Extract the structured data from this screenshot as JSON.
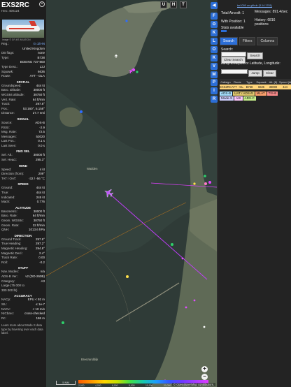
{
  "info": {
    "callsign": "EXS2RC",
    "hex_line": "Hex: 400124",
    "registration_link": "G-JZHN",
    "photo_credit": "Image © GF-MT AVIATION",
    "general": [
      {
        "label": "Reg.:",
        "value": ""
      },
      {
        "label": "",
        "value": "United Kingdom"
      },
      {
        "label": "DB flags:",
        "value": "none"
      },
      {
        "label": "Type:",
        "value": "B738"
      },
      {
        "label": "",
        "value": "BOEING 737-800"
      },
      {
        "label": "Type Desc.:",
        "value": "L2J"
      },
      {
        "label": "Squawk:",
        "value": "6636"
      },
      {
        "label": "Route:",
        "value": "AYT - GLA"
      }
    ],
    "spatial_title": "SPATIAL",
    "spatial": [
      {
        "label": "Groundspeed:",
        "value": "444 kt"
      },
      {
        "label": "Baro. altitude:",
        "value": "38000 ft"
      },
      {
        "label": "WGS84 altitude:",
        "value": "38750 ft"
      },
      {
        "label": "Vert. Rate:",
        "value": "64 ft/min"
      },
      {
        "label": "Track:",
        "value": "297.8°"
      },
      {
        "label": "Pos.:",
        "value": "53.160°, 5.158°"
      },
      {
        "label": "Distance:",
        "value": "27.7 nmi"
      }
    ],
    "signal_title": "SIGNAL",
    "signal": [
      {
        "label": "Source:",
        "value": "ADS-B"
      },
      {
        "label": "RSSI:",
        "value": "-2.9"
      },
      {
        "label": "Msg. Rate:",
        "value": "72.5"
      },
      {
        "label": "Messages:",
        "value": "53020"
      },
      {
        "label": "Last Pos.:",
        "value": "0.1 s"
      },
      {
        "label": "Last Seen:",
        "value": "0.0 s"
      }
    ],
    "fms_title": "FMS SEL",
    "fms": [
      {
        "label": "Sel. Alt.:",
        "value": "38000 ft"
      },
      {
        "label": "Sel. Head.:",
        "value": "295.3°"
      }
    ],
    "wind_title": "WIND",
    "wind": [
      {
        "label": "Speed:",
        "value": "4 kt"
      },
      {
        "label": "Direction (from):",
        "value": "209°"
      },
      {
        "label": "TAT / OAT:",
        "value": "-32 / -56 °C"
      }
    ],
    "speed_title": "SPEED",
    "speed": [
      {
        "label": "Ground:",
        "value": "444 kt"
      },
      {
        "label": "True:",
        "value": "444 kt"
      },
      {
        "label": "Indicated:",
        "value": "245 kt"
      },
      {
        "label": "Mach:",
        "value": "0.776"
      }
    ],
    "altitude_title": "ALTITUDE",
    "altitude": [
      {
        "label": "Barometric:",
        "value": "38000 ft"
      },
      {
        "label": "Baro. Rate:",
        "value": "64 ft/min"
      },
      {
        "label": "Geom. WGS84:",
        "value": "38750 ft"
      },
      {
        "label": "Geom. Rate:",
        "value": "32 ft/min"
      },
      {
        "label": "QNH:",
        "value": "1013.6 hPa"
      }
    ],
    "direction_title": "DIRECTION",
    "direction": [
      {
        "label": "Ground Track:",
        "value": "297.8°"
      },
      {
        "label": "True Heading:",
        "value": "297.2°"
      },
      {
        "label": "Magnetic Heading:",
        "value": "294.8°"
      },
      {
        "label": "Magnetic Decl.:",
        "value": "2.4°"
      },
      {
        "label": "Track Rate:",
        "value": "0.00"
      },
      {
        "label": "Roll:",
        "value": "-0.2"
      }
    ],
    "stuff_title": "STUFF",
    "stuff": [
      {
        "label": "Nav. Modes:",
        "value": "n/a"
      },
      {
        "label": "ADS-B Ver.:",
        "value": "v2 (DO-260B)"
      },
      {
        "label": "Category:",
        "value": "A3"
      },
      {
        "label": "Large (75 000 to",
        "value": ""
      },
      {
        "label": "300 000 lb)",
        "value": ""
      }
    ],
    "accuracy_title": "ACCURACY",
    "accuracy": [
      {
        "label": "NACp:",
        "value": "EPU < 92 m"
      },
      {
        "label": "SIL:",
        "value": "≤ 1e-7"
      },
      {
        "label": "NACv:",
        "value": "< 10 m/s"
      },
      {
        "label": "NICbaro:",
        "value": "cross-checked"
      },
      {
        "label": "Rc:",
        "value": "186 m"
      }
    ],
    "footer": "Learn more about Mode S data type by hovering over each data label."
  },
  "map": {
    "top_buttons": [
      "U",
      "H",
      "T"
    ],
    "zoom_in": "+",
    "zoom_out": "−",
    "scale_label": "5 NM",
    "attribution": "© OpenStreetMap contributors.",
    "place_labels": [
      "Wadden",
      "Breezanddijk"
    ],
    "legend_ticks": [
      "2,000",
      "4,000",
      "6,000",
      "8,000",
      "10,000",
      "20,000",
      "30,000",
      "40,000+"
    ]
  },
  "tools": [
    "◀",
    "F",
    "⊙",
    "K",
    "L",
    "O",
    "K",
    "V",
    "M",
    "P",
    "I",
    "R"
  ],
  "right": {
    "top_link": "tar1090 on github (3.14.1781)",
    "total_aircraft": "Total Aircraft: 1",
    "messages": "Messages: 891.4/sec",
    "with_position": "With Position: 1",
    "history": "History: 6816 positions",
    "stats_label": "Stats available",
    "tabs": [
      "Search",
      "Filters",
      "Columns"
    ],
    "search_label": "Search:",
    "search_button": "Search",
    "clear_search": "Clear Search",
    "jump_label": "Jump to Airport or Latitude, Longitude:",
    "jump_button": "Jump",
    "clear_button": "Clear",
    "table_headers": [
      "Callsign",
      "Route",
      "Type",
      "Squawk",
      "Alt. (ft)",
      "Speed (kt)"
    ],
    "table_row": [
      "EXS2RC",
      "AYT - GLA",
      "B738",
      "6636",
      "38000",
      "444"
    ],
    "source_chips": [
      {
        "label": "ADS-B",
        "color": "#a6e0ff"
      },
      {
        "label": "UAT / ADS-R",
        "color": "#e1c86e"
      },
      {
        "label": "MLAT",
        "color": "#ffa36e"
      },
      {
        "label": "TIS-B",
        "color": "#ff8e8e"
      },
      {
        "label": "Mode-S",
        "color": "#cfcfff"
      },
      {
        "label": "AIS",
        "color": "#ffc8ff"
      },
      {
        "label": "ADS-C",
        "color": "#c8f08c"
      }
    ]
  }
}
